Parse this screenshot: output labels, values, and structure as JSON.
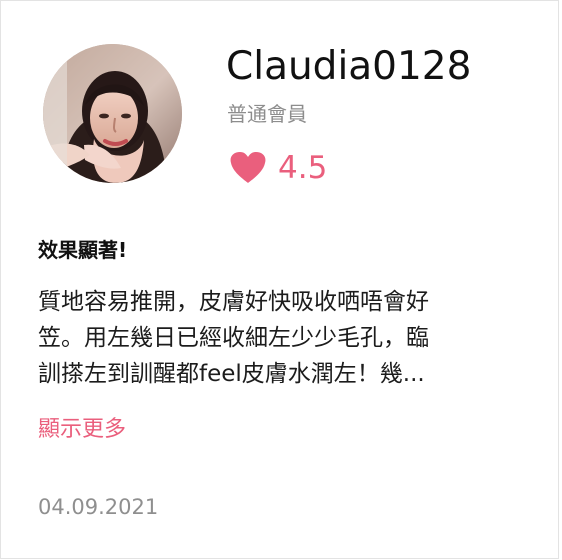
{
  "profile": {
    "username": "Claudia0128",
    "member_level": "普通會員",
    "rating": "4.5",
    "heart_color": "#ea5f7d"
  },
  "review": {
    "title": "效果顯著!",
    "body_lines": [
      "質地容易推開，皮膚好快吸收哂唔會好",
      "笠。用左幾日已經收細左少少毛孔，臨",
      "訓搽左到訓醒都feel皮膚水潤左！幾..."
    ],
    "show_more_label": "顯示更多",
    "date": "04.09.2021"
  },
  "icons": {
    "avatar": "avatar-image",
    "rating": "heart-icon"
  }
}
